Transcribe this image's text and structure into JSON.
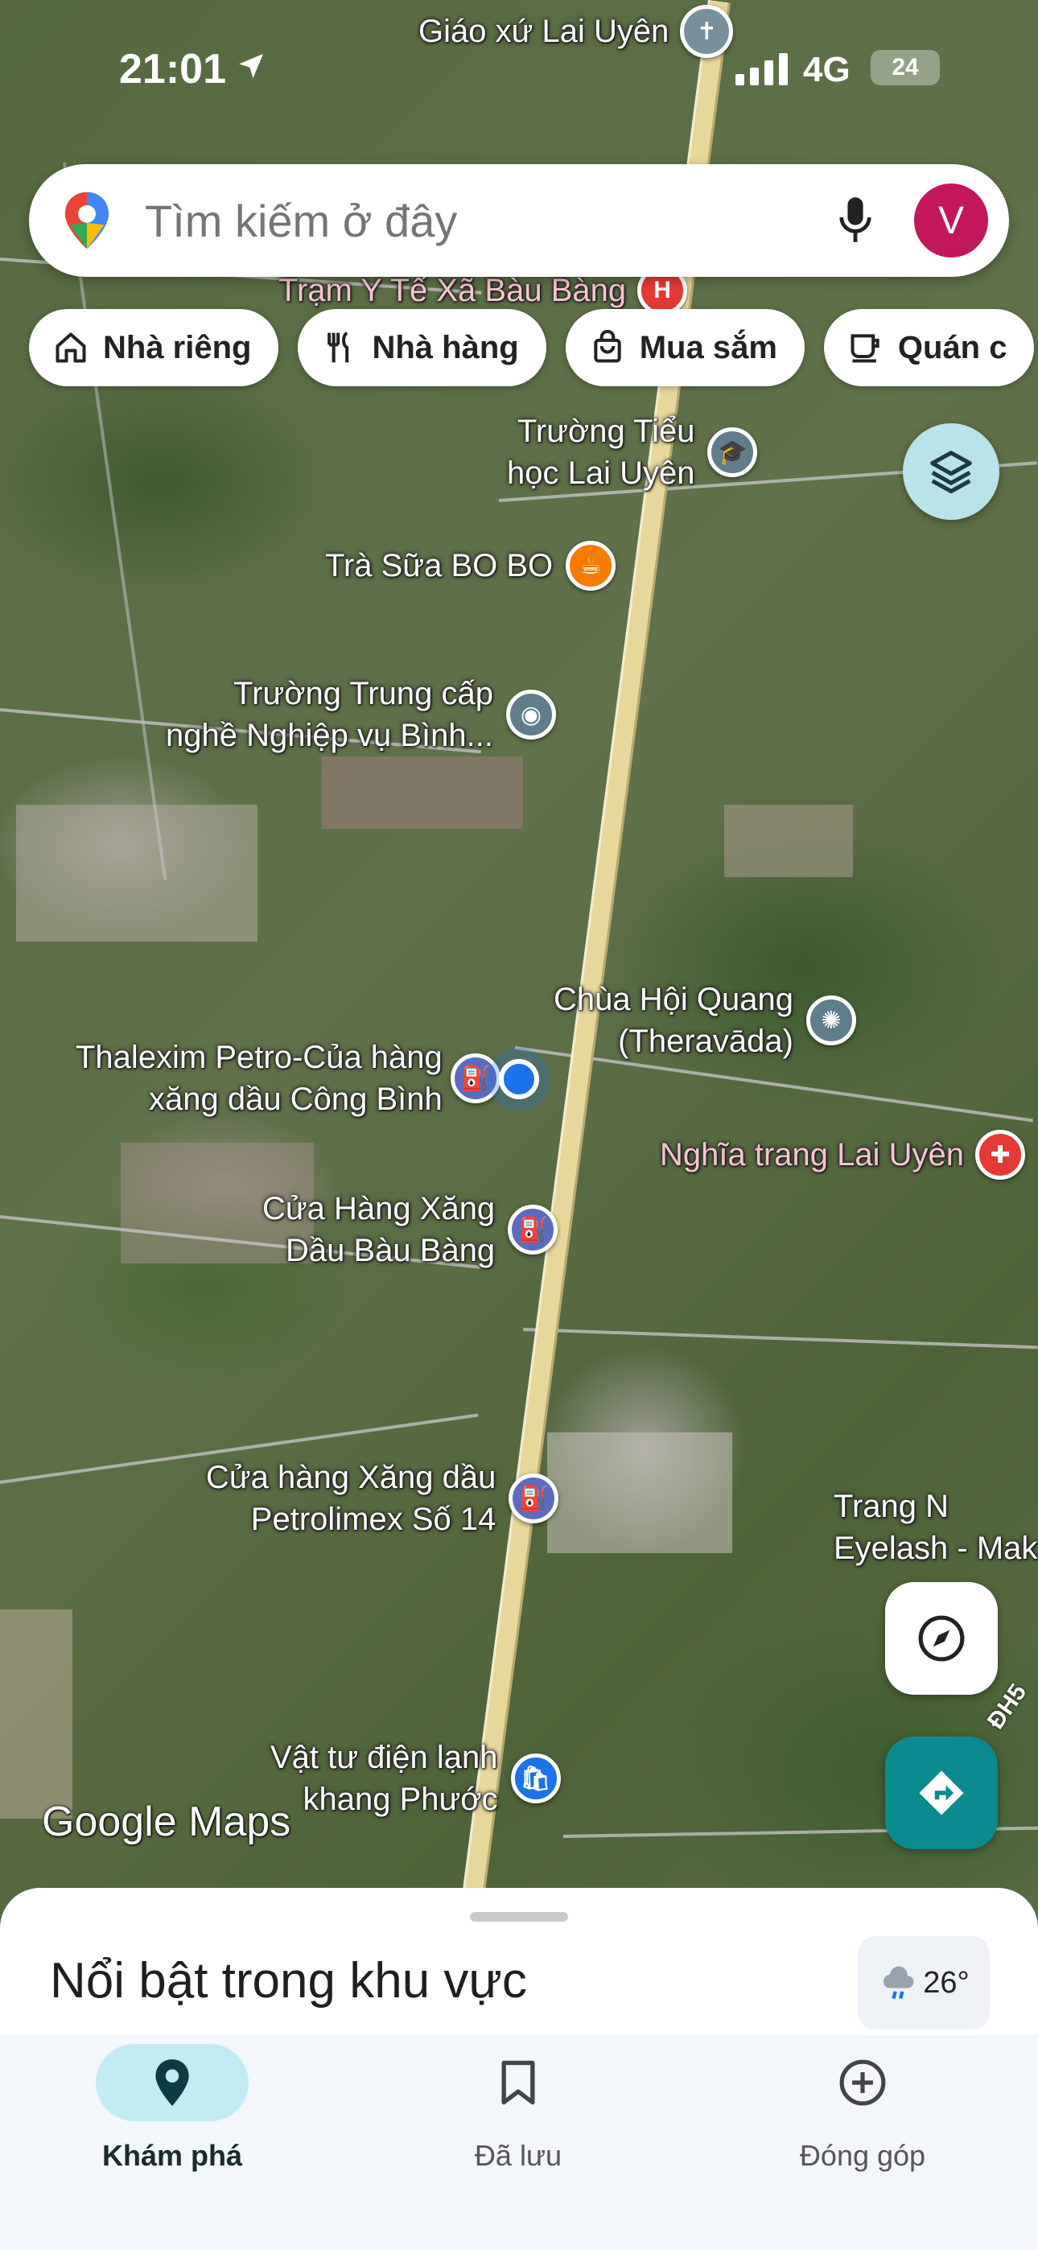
{
  "status": {
    "time": "21:01",
    "network": "4G",
    "battery": "24"
  },
  "search": {
    "placeholder": "Tìm kiếm ở đây",
    "avatar_letter": "V"
  },
  "chips": [
    {
      "label": "Nhà riêng",
      "icon": "home-icon"
    },
    {
      "label": "Nhà hàng",
      "icon": "restaurant-icon"
    },
    {
      "label": "Mua sắm",
      "icon": "shopping-bag-icon"
    },
    {
      "label": "Quán c",
      "icon": "coffee-icon"
    }
  ],
  "pois": {
    "church": "Giáo xứ Lai Uyên",
    "clinic": "Trạm Y Tế Xã Bàu Bàng",
    "school": "Trường Tiểu\nhọc Lai Uyên",
    "tea": "Trà Sữa BO BO",
    "vocational": "Trường Trung cấp\nnghề Nghiệp vụ Bình...",
    "temple": "Chùa Hội Quang\n(Theravāda)",
    "thalexim": "Thalexim Petro-Của hàng\nxăng dầu Công Bình",
    "cemetery": "Nghĩa trang Lai Uyên",
    "gas_bau_bang": "Cửa Hàng Xăng\nDầu Bàu Bàng",
    "petrolimex": "Cửa hàng Xăng dầu\nPetrolimex Số 14",
    "eyelash": "Trang N\nEyelash - Mak",
    "hvac": "Vật tư điện lạnh\nkhang Phước",
    "road": "ĐH5"
  },
  "watermark": "Google Maps",
  "sheet": {
    "title": "Nổi bật trong khu vực",
    "temperature": "26°"
  },
  "nav": {
    "explore": "Khám phá",
    "saved": "Đã lưu",
    "contribute": "Đóng góp"
  },
  "colors": {
    "accent": "#0b8a8f",
    "active_nav": "#c2ecf3",
    "pin_blue": "#1a73e8",
    "pin_gray": "#607d8b",
    "pin_orange": "#f57c00",
    "pin_red": "#e53935"
  }
}
